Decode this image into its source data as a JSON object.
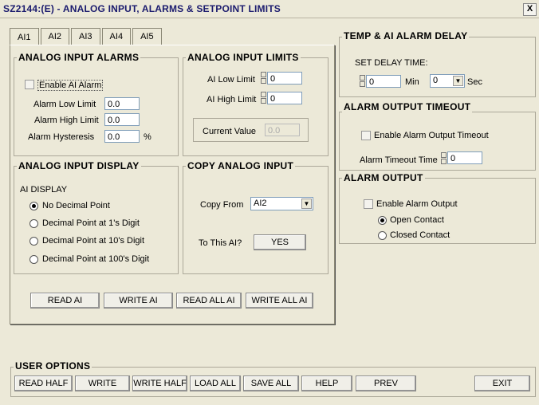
{
  "window": {
    "title": "SZ2144:(E) - ANALOG INPUT, ALARMS & SETPOINT LIMITS",
    "close": "X"
  },
  "tabs": [
    "AI1",
    "AI2",
    "AI3",
    "AI4",
    "AI5"
  ],
  "analog_input_alarms": {
    "title": "ANALOG INPUT ALARMS",
    "enable_label": "Enable AI Alarm",
    "low_label": "Alarm Low Limit",
    "low_value": "0.0",
    "high_label": "Alarm High Limit",
    "high_value": "0.0",
    "hyst_label": "Alarm Hysteresis",
    "hyst_value": "0.0",
    "hyst_unit": "%"
  },
  "analog_input_limits": {
    "title": "ANALOG INPUT LIMITS",
    "low_label": "AI Low Limit",
    "low_value": "0",
    "high_label": "AI High Limit",
    "high_value": "0",
    "current_label": "Current Value",
    "current_value": "0.0"
  },
  "analog_input_display": {
    "title": "ANALOG INPUT DISPLAY",
    "subtitle": "AI DISPLAY",
    "options": [
      "No Decimal Point",
      "Decimal Point at 1's Digit",
      "Decimal Point at 10's Digit",
      "Decimal Point at 100's Digit"
    ]
  },
  "copy_analog_input": {
    "title": "COPY ANALOG INPUT",
    "from_label": "Copy From",
    "from_value": "AI2",
    "to_label": "To This AI?",
    "yes_label": "YES"
  },
  "ai_buttons": {
    "read": "READ AI",
    "write": "WRITE AI",
    "read_all": "READ ALL AI",
    "write_all": "WRITE ALL AI"
  },
  "temp_delay": {
    "title": "TEMP & AI ALARM DELAY",
    "set_label": "SET DELAY TIME:",
    "min_value": "0",
    "min_label": "Min",
    "sec_value": "0",
    "sec_label": "Sec"
  },
  "alarm_timeout": {
    "title": "ALARM OUTPUT TIMEOUT",
    "enable_label": "Enable Alarm Output Timeout",
    "time_label": "Alarm Timeout Time",
    "time_value": "0"
  },
  "alarm_output": {
    "title": "ALARM OUTPUT",
    "enable_label": "Enable Alarm Output",
    "open_label": "Open Contact",
    "closed_label": "Closed Contact"
  },
  "user_options": {
    "title": "USER OPTIONS",
    "buttons": [
      "READ HALF",
      "WRITE",
      "WRITE HALF",
      "LOAD ALL",
      "SAVE ALL",
      "HELP",
      "PREV",
      "EXIT"
    ]
  }
}
